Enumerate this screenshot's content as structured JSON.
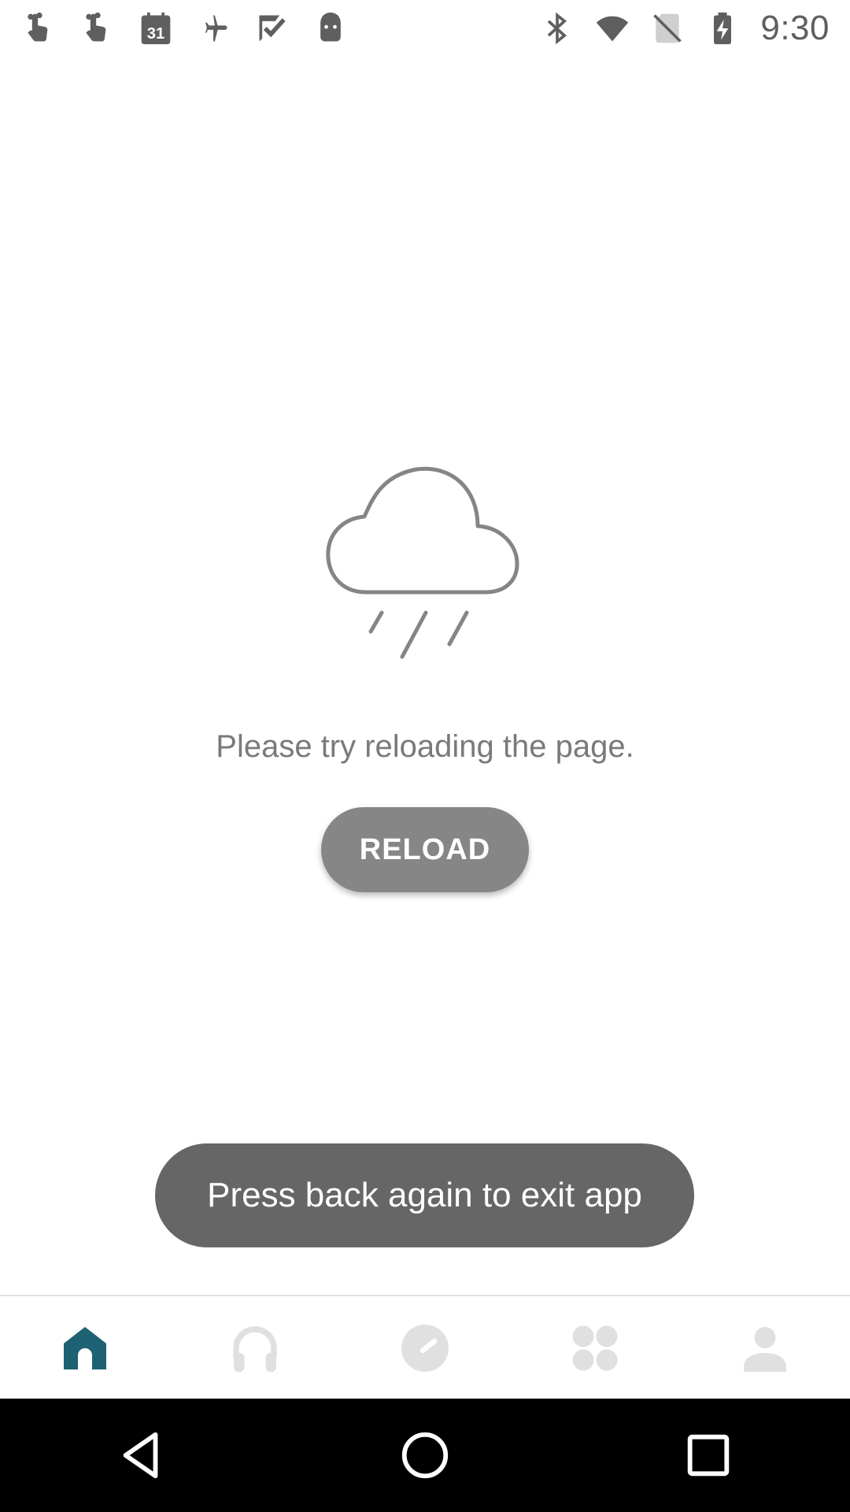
{
  "status_bar": {
    "time": "9:30",
    "left_icons": [
      "touch-gesture-icon",
      "touch-gesture-icon",
      "calendar-icon",
      "airplane-icon",
      "tasks-check-icon",
      "android-icon"
    ],
    "calendar_day": "31",
    "right_icons": [
      "bluetooth-icon",
      "wifi-icon",
      "no-sim-icon",
      "battery-charging-icon"
    ]
  },
  "error": {
    "icon": "rain-cloud-icon",
    "message": "Please try reloading the page.",
    "reload_label": "RELOAD"
  },
  "toast": {
    "text": "Press back again to exit app"
  },
  "bottom_nav": {
    "items": [
      {
        "icon": "home-icon",
        "active": true
      },
      {
        "icon": "headphones-icon",
        "active": false
      },
      {
        "icon": "gauge-icon",
        "active": false
      },
      {
        "icon": "grid-icon",
        "active": false
      },
      {
        "icon": "profile-icon",
        "active": false
      }
    ]
  },
  "system_nav": {
    "buttons": [
      "back-icon",
      "home-circle-icon",
      "recents-icon"
    ]
  },
  "colors": {
    "accent": "#1c6273",
    "inactive_icon": "#e0e0e0",
    "reload_bg": "#868686",
    "toast_bg": "#666666",
    "status_icon": "#5f5f5f"
  }
}
